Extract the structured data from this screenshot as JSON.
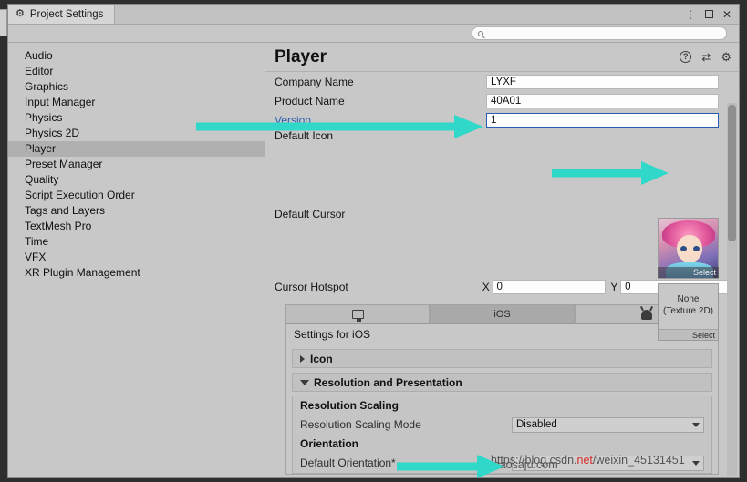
{
  "window": {
    "tab_title": "Project Settings",
    "gear_icon": "gear-icon",
    "kebab": "⋮",
    "maximize": "□",
    "close": "✕"
  },
  "search": {
    "placeholder": "",
    "icon": "search-icon"
  },
  "sidebar": {
    "items": [
      {
        "label": "Audio",
        "selected": false
      },
      {
        "label": "Editor",
        "selected": false
      },
      {
        "label": "Graphics",
        "selected": false
      },
      {
        "label": "Input Manager",
        "selected": false
      },
      {
        "label": "Physics",
        "selected": false
      },
      {
        "label": "Physics 2D",
        "selected": false
      },
      {
        "label": "Player",
        "selected": true
      },
      {
        "label": "Preset Manager",
        "selected": false
      },
      {
        "label": "Quality",
        "selected": false
      },
      {
        "label": "Script Execution Order",
        "selected": false
      },
      {
        "label": "Tags and Layers",
        "selected": false
      },
      {
        "label": "TextMesh Pro",
        "selected": false
      },
      {
        "label": "Time",
        "selected": false
      },
      {
        "label": "VFX",
        "selected": false
      },
      {
        "label": "XR Plugin Management",
        "selected": false
      }
    ]
  },
  "player": {
    "title": "Player",
    "header_icons": [
      "help-icon",
      "preset-icon",
      "settings-gear-icon"
    ],
    "company_name": {
      "label": "Company Name",
      "value": "LYXF"
    },
    "product_name": {
      "label": "Product Name",
      "value": "40A01"
    },
    "version": {
      "label": "Version",
      "value": "1"
    },
    "default_icon": {
      "label": "Default Icon",
      "select_label": "Select"
    },
    "default_cursor": {
      "label": "Default Cursor",
      "value_line1": "None",
      "value_line2": "(Texture 2D)",
      "select_label": "Select"
    },
    "cursor_hotspot": {
      "label": "Cursor Hotspot",
      "x_label": "X",
      "x_value": "0",
      "y_label": "Y",
      "y_value": "0"
    },
    "platform_tabs": [
      {
        "icon": "desktop-icon",
        "label": "",
        "active": false
      },
      {
        "icon": "",
        "label": "iOS",
        "active": true
      },
      {
        "icon": "android-icon",
        "label": "",
        "active": false
      }
    ],
    "settings_header": "Settings for iOS",
    "icon_foldout": "Icon",
    "resolution_foldout": "Resolution and Presentation",
    "resolution_scaling_header": "Resolution Scaling",
    "resolution_scaling_mode": {
      "label": "Resolution Scaling Mode",
      "value": "Disabled"
    },
    "orientation_header": "Orientation",
    "default_orientation": {
      "label": "Default Orientation*",
      "value": ""
    }
  },
  "watermark": {
    "prefix": "https://blog.csdn.",
    "highlight": "net",
    "suffix": "/weixin_45131451",
    "ghost": "ianaosaju.com"
  },
  "annotations": {
    "arrow_color": "#2fd8c8",
    "arrows": [
      {
        "name": "arrow-to-version-field"
      },
      {
        "name": "arrow-to-default-icon"
      },
      {
        "name": "arrow-to-default-orientation"
      }
    ]
  }
}
